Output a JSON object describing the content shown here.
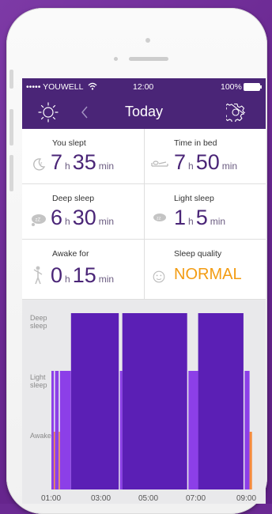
{
  "status_bar": {
    "carrier": "••••• YOUWELL",
    "time": "12:00",
    "battery": "100%"
  },
  "nav": {
    "title": "Today",
    "left_icon": "sun-icon",
    "back_icon": "chevron-left-icon",
    "settings_icon": "gear-icon"
  },
  "stats": {
    "you_slept": {
      "label": "You slept",
      "hours": "7",
      "h_unit": "h",
      "minutes": "35",
      "m_unit": "min"
    },
    "time_in_bed": {
      "label": "Time in bed",
      "hours": "7",
      "h_unit": "h",
      "minutes": "50",
      "m_unit": "min"
    },
    "deep_sleep": {
      "label": "Deep sleep",
      "hours": "6",
      "h_unit": "h",
      "minutes": "30",
      "m_unit": "min"
    },
    "light_sleep": {
      "label": "Light sleep",
      "hours": "1",
      "h_unit": "h",
      "minutes": "5",
      "m_unit": "min"
    },
    "awake_for": {
      "label": "Awake for",
      "hours": "0",
      "h_unit": "h",
      "minutes": "15",
      "m_unit": "min"
    },
    "sleep_quality": {
      "label": "Sleep quality",
      "value": "NORMAL"
    }
  },
  "colors": {
    "header": "#4a2577",
    "accent_text": "#4a2577",
    "quality": "#f39c12",
    "deep": "#5b1fb5",
    "light": "#8c3fe8",
    "awake": "#f58b3c"
  },
  "chart_data": {
    "type": "bar",
    "ylabels": [
      "Deep\nsleep",
      "Light\nsleep",
      "Awake"
    ],
    "xlabels": [
      "01:00",
      "03:00",
      "05:00",
      "07:00",
      "09:00"
    ],
    "x_unit": "hours",
    "xlim": [
      1.0,
      9.5
    ],
    "levels": {
      "Awake": 1,
      "Light sleep": 2,
      "Deep sleep": 3
    },
    "segments": [
      {
        "start": 1.0,
        "end": 1.1,
        "stage": "Light sleep"
      },
      {
        "start": 1.1,
        "end": 1.15,
        "stage": "Awake"
      },
      {
        "start": 1.15,
        "end": 1.3,
        "stage": "Light sleep"
      },
      {
        "start": 1.3,
        "end": 1.35,
        "stage": "Awake"
      },
      {
        "start": 1.35,
        "end": 1.8,
        "stage": "Light sleep"
      },
      {
        "start": 1.8,
        "end": 3.8,
        "stage": "Deep sleep"
      },
      {
        "start": 3.8,
        "end": 3.9,
        "stage": "Light sleep"
      },
      {
        "start": 3.9,
        "end": 6.6,
        "stage": "Deep sleep"
      },
      {
        "start": 6.6,
        "end": 7.0,
        "stage": "Light sleep"
      },
      {
        "start": 7.0,
        "end": 8.9,
        "stage": "Deep sleep"
      },
      {
        "start": 8.9,
        "end": 9.1,
        "stage": "Light sleep"
      },
      {
        "start": 9.1,
        "end": 9.2,
        "stage": "Awake"
      }
    ]
  }
}
